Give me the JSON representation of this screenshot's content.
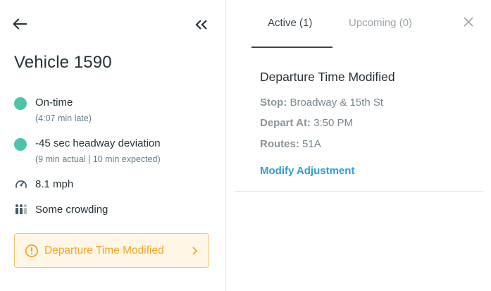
{
  "vehicle": {
    "title": "Vehicle 1590"
  },
  "status": {
    "on_time": {
      "label": "On-time",
      "detail": "(4:07 min late)"
    },
    "headway": {
      "label": "-45 sec headway deviation",
      "detail": "(9 min actual | 10 min expected)"
    },
    "speed": "8.1 mph",
    "crowding": "Some crowding",
    "dot_color": "#4fc3a9"
  },
  "alert": {
    "label": "Departure Time Modified",
    "color": "#f5a524"
  },
  "tabs": [
    {
      "label": "Active (1)",
      "active": true
    },
    {
      "label": "Upcoming (0)",
      "active": false
    }
  ],
  "adjustment": {
    "title": "Departure Time Modified",
    "stop_label": "Stop:",
    "stop_value": "Broadway & 15th St",
    "depart_label": "Depart At:",
    "depart_value": "3:50 PM",
    "routes_label": "Routes:",
    "routes_value": "51A",
    "modify_link": "Modify Adjustment",
    "link_color": "#2a9fd8"
  },
  "icons": {
    "back": "arrow-left-icon",
    "collapse": "double-chevron-left-icon",
    "close": "close-icon",
    "speed": "speedometer-icon",
    "crowding": "people-icon",
    "alert": "warning-circle-icon",
    "chevron": "chevron-right-icon"
  }
}
